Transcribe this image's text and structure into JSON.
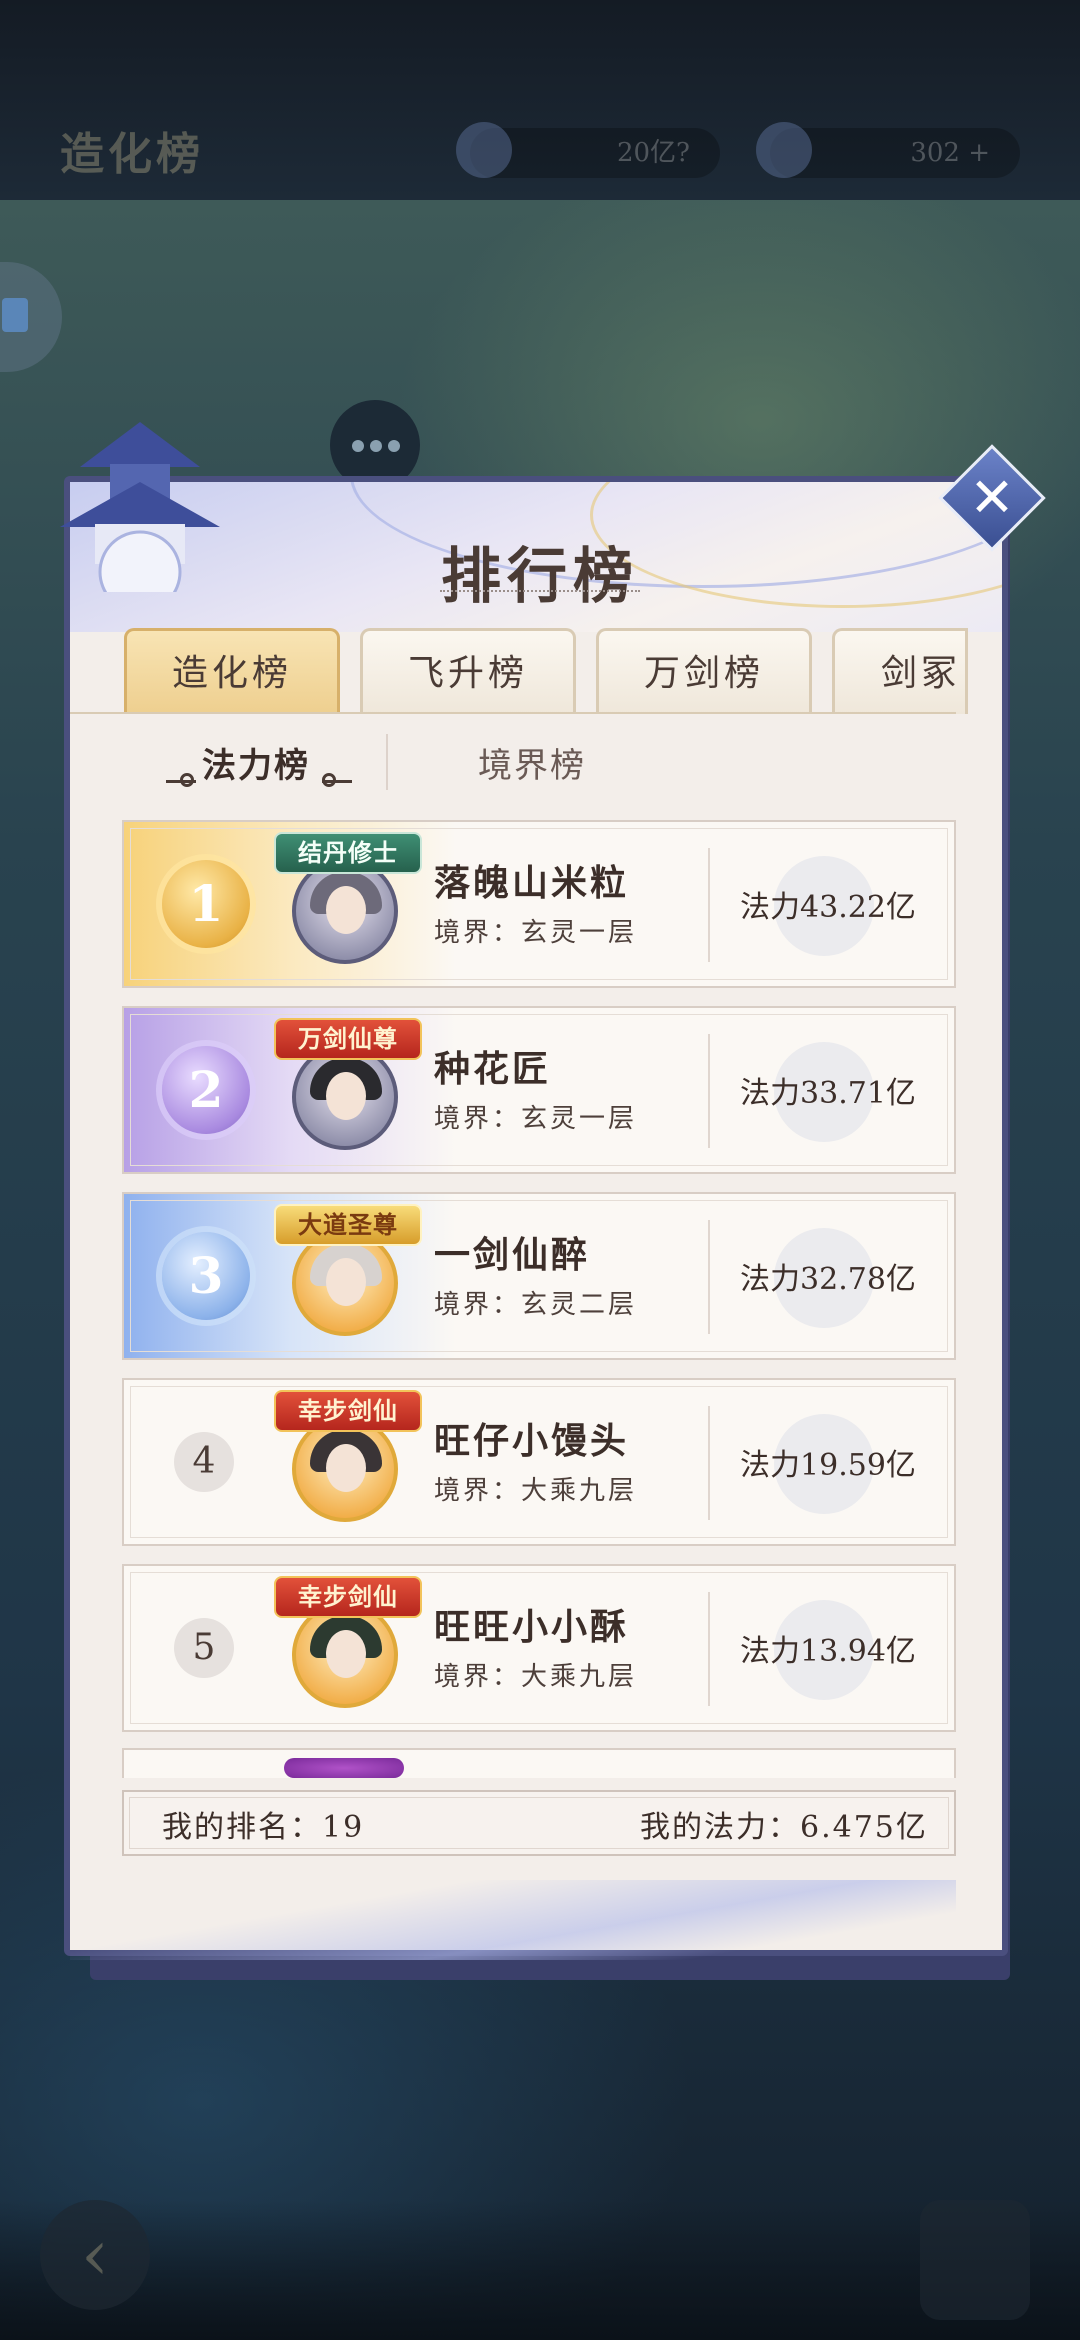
{
  "background": {
    "hud_title": "造化榜",
    "resource1": "20亿?",
    "resource2": "302 +"
  },
  "dialog": {
    "title": "排行榜",
    "close_icon": "close-icon",
    "tabs": [
      "造化榜",
      "飞升榜",
      "万剑榜",
      "剑冢"
    ],
    "active_tab": 0,
    "subtabs": [
      "法力榜",
      "境界榜"
    ],
    "active_subtab": 0,
    "rows": [
      {
        "rank": "1",
        "badge": "结丹修士",
        "name": "落魄山米粒",
        "realm": "境界：玄灵一层",
        "power": "法力43.22亿"
      },
      {
        "rank": "2",
        "badge": "万剑仙尊",
        "name": "种花匠",
        "realm": "境界：玄灵一层",
        "power": "法力33.71亿"
      },
      {
        "rank": "3",
        "badge": "大道圣尊",
        "name": "一剑仙醉",
        "realm": "境界：玄灵二层",
        "power": "法力32.78亿"
      },
      {
        "rank": "4",
        "badge": "幸步剑仙",
        "name": "旺仔小馒头",
        "realm": "境界：大乘九层",
        "power": "法力19.59亿"
      },
      {
        "rank": "5",
        "badge": "幸步剑仙",
        "name": "旺旺小小酥",
        "realm": "境界：大乘九层",
        "power": "法力13.94亿"
      }
    ],
    "my_rank_label": "我的排名：",
    "my_rank_value": "19",
    "my_power_label": "我的法力：",
    "my_power_value": "6.475亿"
  },
  "colors": {
    "dialog_border": "#4a4f7e",
    "tab_active": "#eecf8f",
    "text": "#3c2e29"
  }
}
